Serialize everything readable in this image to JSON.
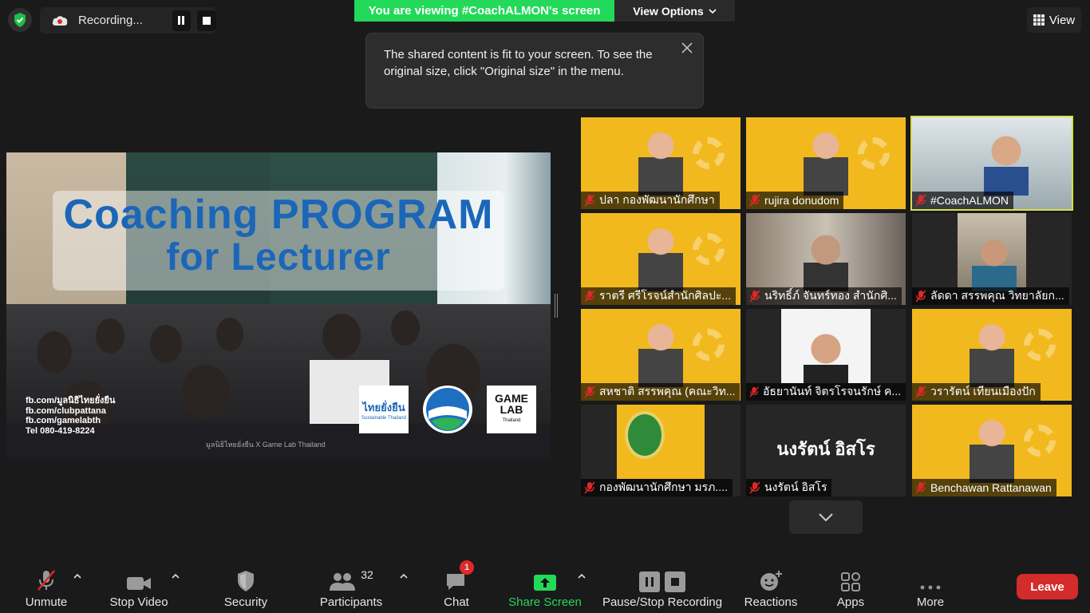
{
  "top": {
    "recording_label": "Recording...",
    "viewing_banner": "You are viewing #CoachALMON's screen",
    "view_options_label": "View Options",
    "view_label": "View"
  },
  "tooltip": {
    "text": "The shared content is fit to your screen. To see the original size, click \"Original size\" in the menu."
  },
  "shared": {
    "title_line1": "Coaching PROGRAM",
    "title_line2": "for Lecturer",
    "contacts": [
      "fb.com/มูลนิธิไทยยั่งยืน",
      "fb.com/clubpattana",
      "fb.com/gamelabth",
      "Tel 080-419-8224"
    ],
    "credit": "มูลนิธิไทยยั่งยืน X Game Lab Thailand",
    "logo1": "ไทยยั่งยืน",
    "logo1_sub": "Sustainable Thailand",
    "logo3_line1": "GAME",
    "logo3_line2": "LAB",
    "logo3_line3": "Thailand"
  },
  "gallery": {
    "tiles": [
      {
        "name": "ปลา กองพัฒนานักศึกษา"
      },
      {
        "name": "rujira donudom"
      },
      {
        "name": "#CoachALMON"
      },
      {
        "name": "ราตรี   ศรีโรจน์สำนักศิลปะ..."
      },
      {
        "name": "นริทธิ์ภ์ จันทร์ทอง สำนักศิ..."
      },
      {
        "name": "ลัดดา สรรพคุณ วิทยาลัยก..."
      },
      {
        "name": "สหชาติ สรรพคุณ (คณะวิท..."
      },
      {
        "name": "อัธยานันท์ จิตรโรจนรักษ์ ค..."
      },
      {
        "name": "วรารัตน์ เทียนเมืองปัก"
      },
      {
        "name": "กองพัฒนานักศึกษา มรภ...."
      },
      {
        "name": "นงรัตน์ อิสโร",
        "display": "นงรัตน์ อิสโร"
      },
      {
        "name": "Benchawan Rattanawan"
      }
    ]
  },
  "toolbar": {
    "unmute": "Unmute",
    "stop_video": "Stop Video",
    "security": "Security",
    "participants": "Participants",
    "participants_count": "32",
    "chat": "Chat",
    "chat_badge": "1",
    "share_screen": "Share Screen",
    "pause_stop_recording": "Pause/Stop Recording",
    "reactions": "Reactions",
    "apps": "Apps",
    "more": "More",
    "leave": "Leave"
  },
  "colors": {
    "green_banner": "#23d959",
    "leave_red": "#d42b2b",
    "active_speaker": "#d7e04a",
    "tile_yellow": "#f2b91e"
  }
}
